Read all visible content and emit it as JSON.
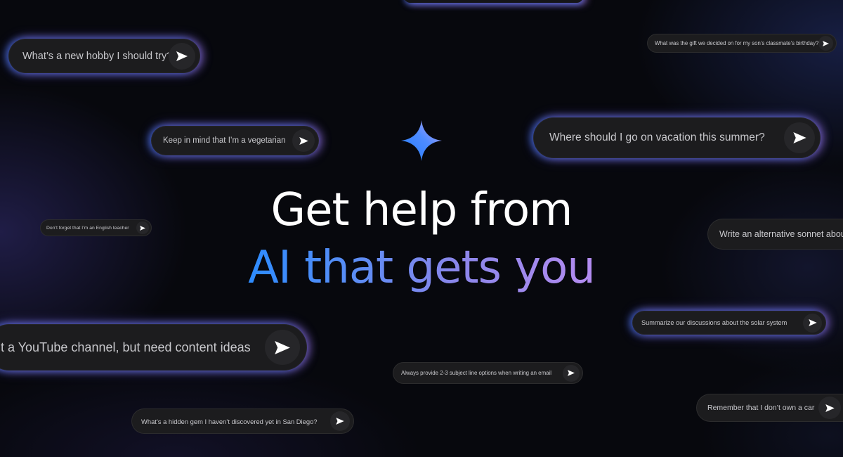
{
  "headline": {
    "line1": "Get help from",
    "line2": "AI that gets you"
  },
  "brand": {
    "sparkle_icon": "gemini-sparkle-icon",
    "gradient_start": "#2d8cff",
    "gradient_end": "#b48cf0"
  },
  "prompts": [
    {
      "text": "What’s a new hobby I should try?",
      "icon": "send-icon"
    },
    {
      "text": "What was the gift we decided on for my son’s classmate’s birthday?",
      "icon": "send-icon"
    },
    {
      "text": "Keep in mind that I’m a vegetarian",
      "icon": "send-icon"
    },
    {
      "text": "Where should I go on vacation this summer?",
      "icon": "send-icon"
    },
    {
      "text": "Don’t forget that I’m an English teacher",
      "icon": "send-icon"
    },
    {
      "text": "Write an alternative sonnet about",
      "icon": "send-icon"
    },
    {
      "text": "t a YouTube channel, but need content ideas",
      "icon": "send-icon"
    },
    {
      "text": "Summarize our discussions about the solar system",
      "icon": "send-icon"
    },
    {
      "text": "Always provide 2-3 subject line options when writing an email",
      "icon": "send-icon"
    },
    {
      "text": "What’s a hidden gem I haven’t discovered yet in San Diego?",
      "icon": "send-icon"
    },
    {
      "text": "Remember that I don’t own a car",
      "icon": "send-icon"
    }
  ]
}
